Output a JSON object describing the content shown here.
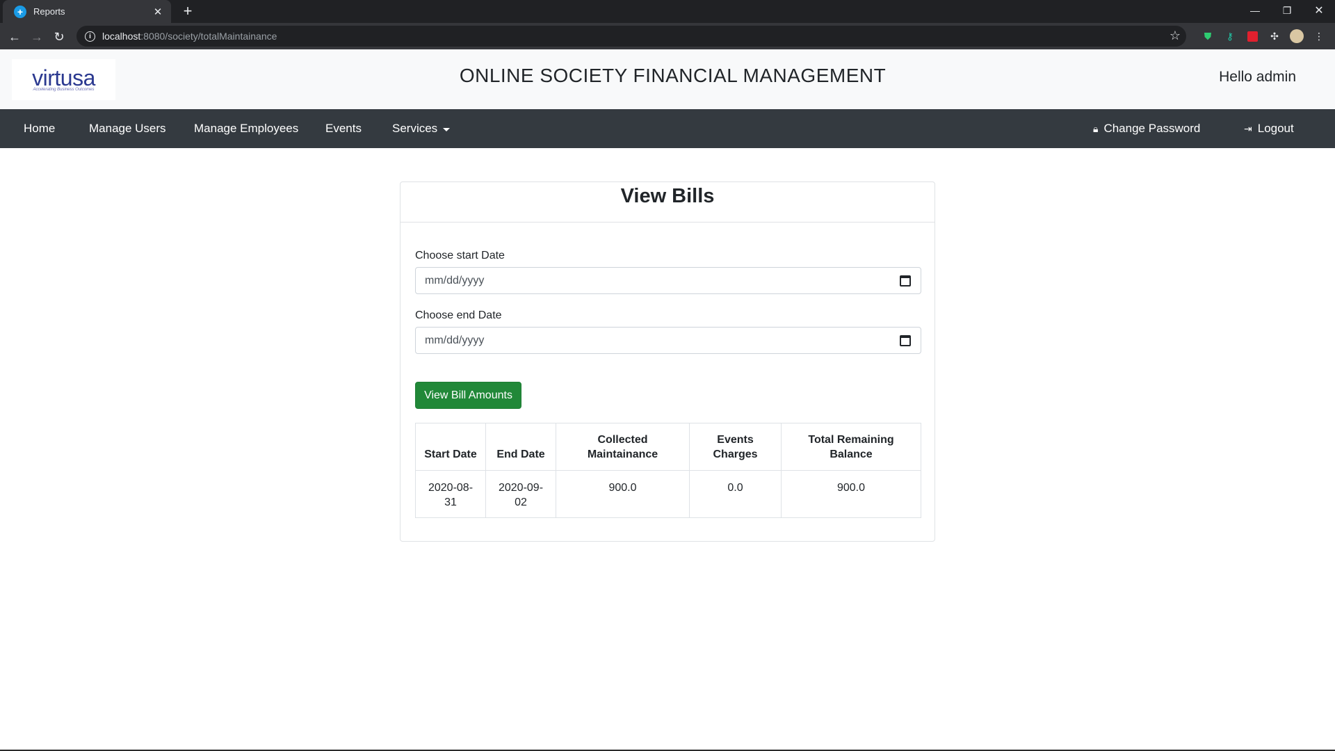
{
  "browser": {
    "tab_title": "Reports",
    "tab_favicon": "+",
    "url_host": "localhost",
    "url_rest": ":8080/society/totalMaintainance"
  },
  "header": {
    "logo_text": "virtusa",
    "logo_tagline": "Accelerating Business Outcomes",
    "site_title": "ONLINE SOCIETY FINANCIAL MANAGEMENT",
    "greeting": "Hello admin"
  },
  "nav": {
    "home": "Home",
    "manage_users": "Manage Users",
    "manage_employees": "Manage Employees",
    "events": "Events",
    "services": "Services",
    "change_password": "Change Password",
    "logout": "Logout"
  },
  "form": {
    "title": "View Bills",
    "start_label": "Choose start Date",
    "start_placeholder": "mm/dd/yyyy",
    "end_label": "Choose end Date",
    "end_placeholder": "mm/dd/yyyy",
    "submit_label": "View Bill Amounts"
  },
  "table": {
    "headers": [
      "Start Date",
      "End Date",
      "Collected Maintainance",
      "Events Charges",
      "Total Remaining Balance"
    ],
    "rows": [
      [
        "2020-08-31",
        "2020-09-02",
        "900.0",
        "0.0",
        "900.0"
      ]
    ]
  },
  "colors": {
    "navbar": "#343a40",
    "header_bg": "#f8f9fa",
    "button_green": "#218838",
    "logo_blue": "#2b3990"
  }
}
